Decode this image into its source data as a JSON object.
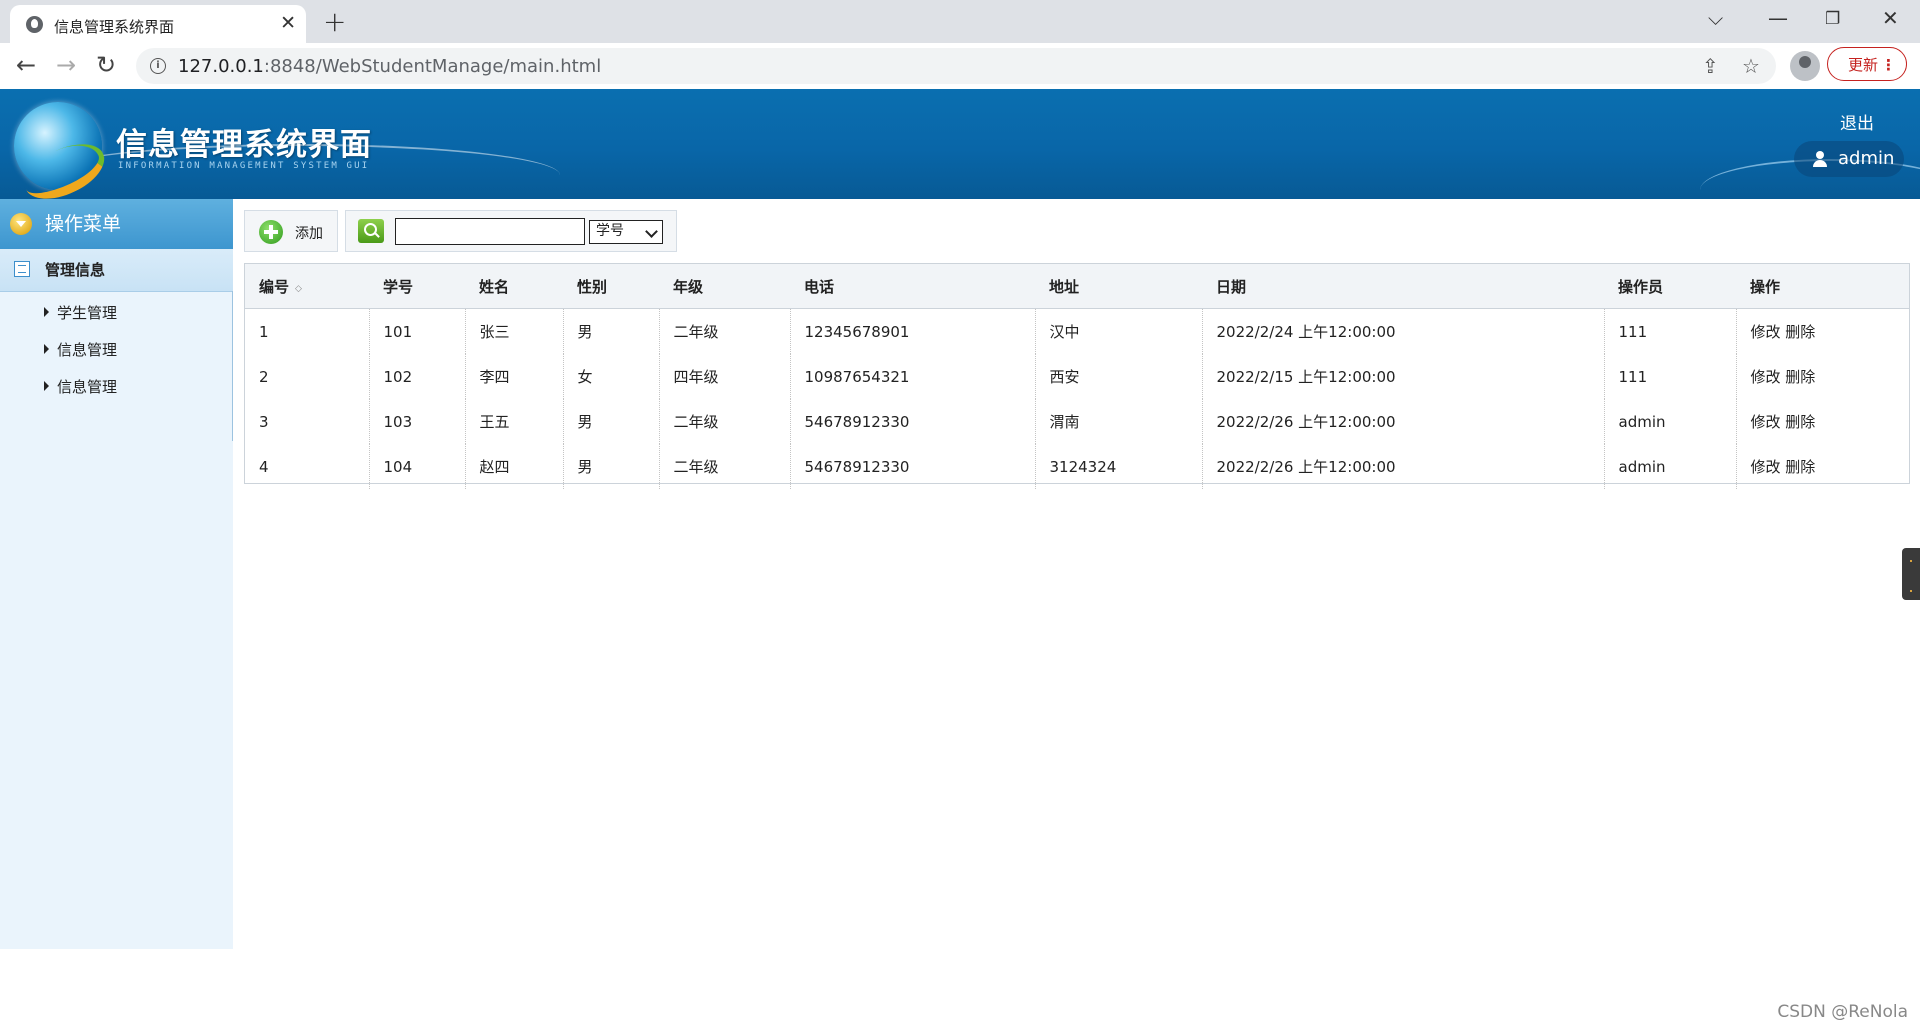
{
  "browser": {
    "tab_title": "信息管理系统界面",
    "url_host": "127.0.0.1",
    "url_rest": ":8848/WebStudentManage/main.html",
    "update_label": "更新"
  },
  "header": {
    "title": "信息管理系统界面",
    "subtitle": "INFORMATION MANAGEMENT SYSTEM GUI",
    "logout": "退出",
    "user": "admin"
  },
  "sidebar": {
    "menu_title": "操作菜单",
    "group_label": "管理信息",
    "items": [
      {
        "label": "学生管理"
      },
      {
        "label": "信息管理"
      },
      {
        "label": "信息管理"
      }
    ]
  },
  "toolbar": {
    "add_label": "添加",
    "search_value": "",
    "search_field": "学号"
  },
  "table": {
    "columns": [
      "编号",
      "学号",
      "姓名",
      "性别",
      "年级",
      "电话",
      "地址",
      "日期",
      "操作员",
      "操作"
    ],
    "edit_label": "修改",
    "delete_label": "删除",
    "rows": [
      {
        "id": "1",
        "sno": "101",
        "name": "张三",
        "gender": "男",
        "grade": "二年级",
        "phone": "12345678901",
        "address": "汉中",
        "date": "2022/2/24 上午12:00:00",
        "operator": "111"
      },
      {
        "id": "2",
        "sno": "102",
        "name": "李四",
        "gender": "女",
        "grade": "四年级",
        "phone": "10987654321",
        "address": "西安",
        "date": "2022/2/15 上午12:00:00",
        "operator": "111"
      },
      {
        "id": "3",
        "sno": "103",
        "name": "王五",
        "gender": "男",
        "grade": "二年级",
        "phone": "54678912330",
        "address": "渭南",
        "date": "2022/2/26 上午12:00:00",
        "operator": "admin"
      },
      {
        "id": "4",
        "sno": "104",
        "name": "赵四",
        "gender": "男",
        "grade": "二年级",
        "phone": "54678912330",
        "address": "3124324",
        "date": "2022/2/26 上午12:00:00",
        "operator": "admin"
      }
    ]
  },
  "watermark": "CSDN @ReNola"
}
